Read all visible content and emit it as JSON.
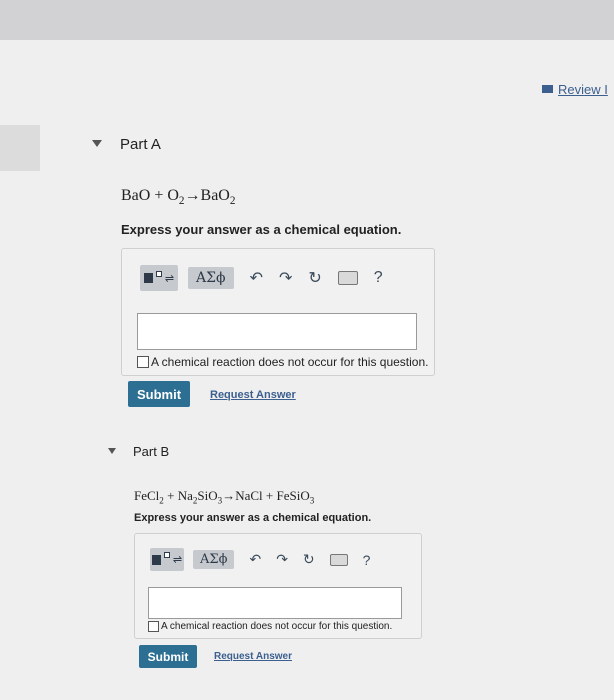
{
  "header": {
    "review_label": "Review I"
  },
  "partA": {
    "label": "Part A",
    "equation": {
      "lhs1": "BaO",
      "plus": " + ",
      "lhs2": "O",
      "lhs2_sub": "2",
      "arrow": "→",
      "rhs": "BaO",
      "rhs_sub": "2"
    },
    "instruction": "Express your answer as a chemical equation.",
    "toolbar": {
      "greek": "ΑΣϕ",
      "help": "?"
    },
    "input_value": "",
    "checkbox_label": "A chemical reaction does not occur for this question.",
    "submit_label": "Submit",
    "request_label": "Request Answer"
  },
  "partB": {
    "label": "Part B",
    "equation": {
      "t1": "FeCl",
      "s1": "2",
      "p1": " + ",
      "t2": "Na",
      "s2": "2",
      "t3": "SiO",
      "s3": "3",
      "arrow": "→",
      "t4": "NaCl",
      "p2": " + ",
      "t5": "FeSiO",
      "s5": "3"
    },
    "instruction": "Express your answer as a chemical equation.",
    "toolbar": {
      "greek": "ΑΣϕ",
      "help": "?"
    },
    "input_value": "",
    "checkbox_label": "A chemical reaction does not occur for this question.",
    "submit_label": "Submit",
    "request_label": "Request Answer"
  },
  "colors": {
    "submit": "#2c6f93",
    "link": "#3b5f8f"
  }
}
